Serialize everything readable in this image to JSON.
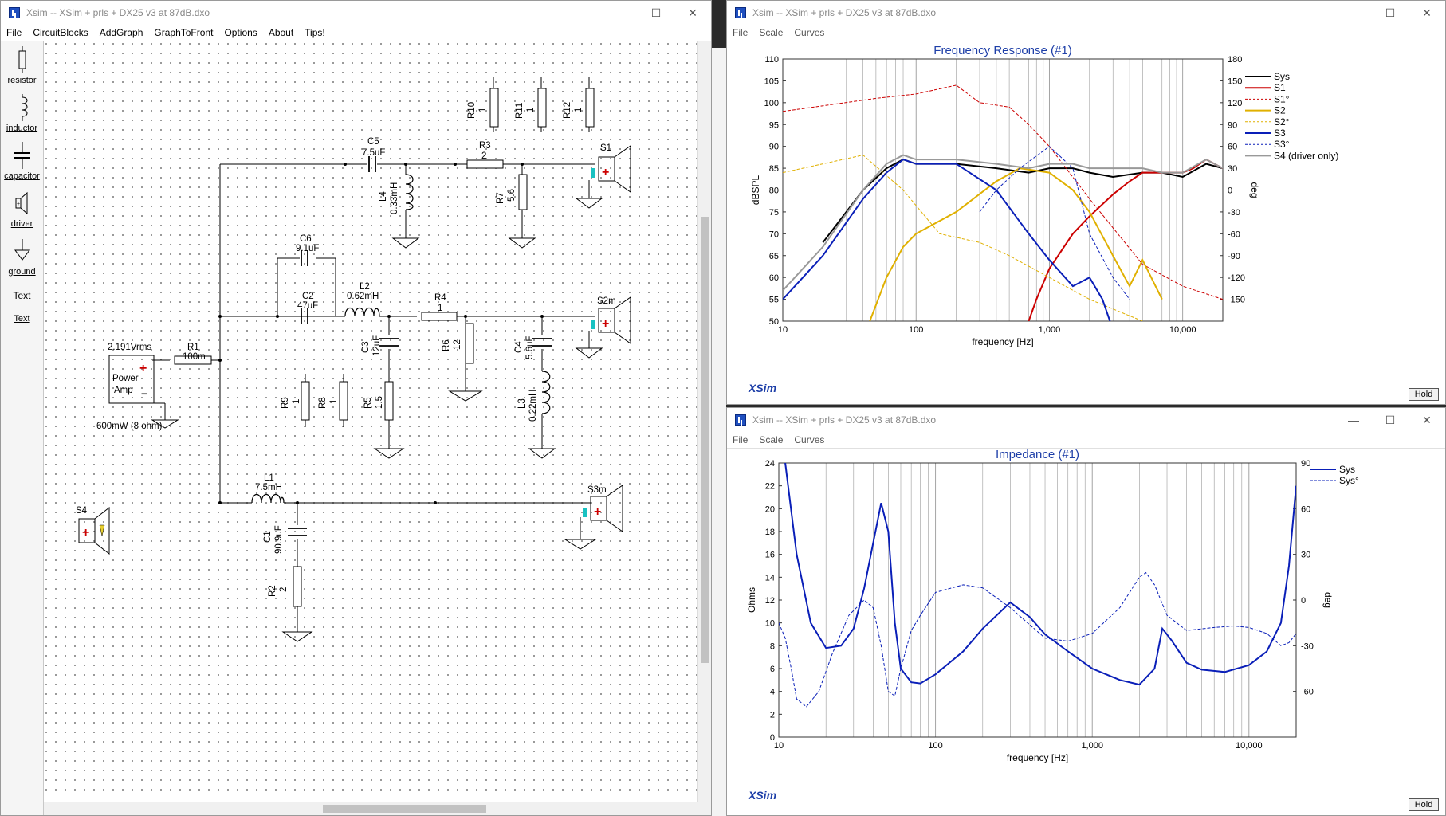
{
  "main_window": {
    "title": "Xsim -- XSim + prls + DX25 v3 at 87dB.dxo",
    "menu": [
      "File",
      "CircuitBlocks",
      "AddGraph",
      "GraphToFront",
      "Options",
      "About",
      "Tips!"
    ],
    "tools": [
      "resistor",
      "inductor",
      "capacitor",
      "driver",
      "ground",
      "Text",
      "Text"
    ]
  },
  "schematic": {
    "source": {
      "voltage": "2.191Vrms",
      "label1": "Power",
      "label2": "Amp",
      "power": "600mW (8 ohm)"
    },
    "components": [
      {
        "name": "R1",
        "value": "100m"
      },
      {
        "name": "C5",
        "value": "7.5uF"
      },
      {
        "name": "R3",
        "value": "2"
      },
      {
        "name": "L4",
        "value": "0.33mH"
      },
      {
        "name": "R7",
        "value": "5.6"
      },
      {
        "name": "R10",
        "value": "1"
      },
      {
        "name": "R11",
        "value": "1"
      },
      {
        "name": "R12",
        "value": "1"
      },
      {
        "name": "C6",
        "value": "9.1uF"
      },
      {
        "name": "C2",
        "value": "47uF"
      },
      {
        "name": "L2",
        "value": "0.62mH"
      },
      {
        "name": "R4",
        "value": "1"
      },
      {
        "name": "C3",
        "value": "12uF"
      },
      {
        "name": "R6",
        "value": "12"
      },
      {
        "name": "C4",
        "value": "5.6uF"
      },
      {
        "name": "L3",
        "value": "0.22mH"
      },
      {
        "name": "R9",
        "value": "1"
      },
      {
        "name": "R8",
        "value": "1"
      },
      {
        "name": "R5",
        "value": "1.5"
      },
      {
        "name": "L1",
        "value": "7.5mH"
      },
      {
        "name": "C1",
        "value": "90.9uF"
      },
      {
        "name": "R2",
        "value": "2"
      }
    ],
    "drivers": [
      "S1",
      "S2m",
      "S3m",
      "S4"
    ]
  },
  "freq_window": {
    "title": "Xsim -- XSim + prls + DX25 v3 at 87dB.dxo",
    "menu": [
      "File",
      "Scale",
      "Curves"
    ],
    "hold": "Hold",
    "brand": "XSim"
  },
  "imp_window": {
    "title": "Xsim -- XSim + prls + DX25 v3 at 87dB.dxo",
    "menu": [
      "File",
      "Scale",
      "Curves"
    ],
    "hold": "Hold",
    "brand": "XSim"
  },
  "chart_data": [
    {
      "type": "line",
      "title": "Frequency Response (#1)",
      "xlabel": "frequency [Hz]",
      "ylabel": "dBSPL",
      "y2label": "deg",
      "xscale": "log",
      "xlim": [
        10,
        20000
      ],
      "ylim": [
        50,
        110
      ],
      "y2lim": [
        -180,
        180
      ],
      "xticks": [
        "10",
        "100",
        "1,000",
        "10,000"
      ],
      "yticks": [
        110,
        105,
        100,
        95,
        90,
        85,
        80,
        75,
        70,
        65,
        60,
        55,
        50
      ],
      "y2ticks": [
        180,
        150,
        120,
        90,
        60,
        30,
        0,
        -30,
        -60,
        -90,
        -120,
        -150
      ],
      "grid": true,
      "legend_position": "right",
      "series": [
        {
          "name": "Sys",
          "color": "#000000",
          "style": "solid",
          "x": [
            20,
            40,
            60,
            80,
            100,
            200,
            400,
            700,
            1000,
            1500,
            2000,
            3000,
            5000,
            7000,
            10000,
            15000,
            20000
          ],
          "y": [
            68,
            80,
            85,
            87,
            86,
            86,
            85,
            84,
            85,
            85,
            84,
            83,
            84,
            84,
            83,
            86,
            85
          ]
        },
        {
          "name": "S1",
          "color": "#cc0000",
          "style": "solid",
          "x": [
            700,
            800,
            1000,
            1500,
            2000,
            3000,
            4000,
            5000,
            7000,
            10000,
            12000,
            15000,
            20000
          ],
          "y": [
            50,
            55,
            62,
            70,
            74,
            79,
            82,
            84,
            84,
            84,
            85,
            87,
            85
          ]
        },
        {
          "name": "S1°",
          "color": "#cc0000",
          "style": "dashed",
          "x": [
            10,
            50,
            100,
            200,
            300,
            500,
            700,
            1000,
            2000,
            5000,
            10000,
            20000
          ],
          "y": [
            98,
            101,
            102,
            104,
            100,
            99,
            95,
            90,
            78,
            63,
            58,
            55
          ]
        },
        {
          "name": "S2",
          "color": "#e0b000",
          "style": "solid",
          "x": [
            45,
            60,
            80,
            100,
            200,
            400,
            600,
            1000,
            1500,
            2000,
            3000,
            4000,
            5000,
            7000
          ],
          "y": [
            50,
            60,
            67,
            70,
            75,
            82,
            85,
            84,
            80,
            75,
            65,
            58,
            64,
            55
          ]
        },
        {
          "name": "S2°",
          "color": "#e0b000",
          "style": "dashed",
          "x": [
            10,
            20,
            40,
            80,
            150,
            300,
            500,
            1000,
            2000,
            5000
          ],
          "y": [
            84,
            86,
            88,
            80,
            70,
            68,
            65,
            60,
            55,
            50
          ]
        },
        {
          "name": "S3",
          "color": "#0a1fb8",
          "style": "solid",
          "x": [
            10,
            20,
            40,
            60,
            80,
            100,
            200,
            400,
            700,
            1000,
            1500,
            2000,
            2500,
            3000
          ],
          "y": [
            55,
            65,
            78,
            84,
            87,
            86,
            86,
            80,
            70,
            64,
            58,
            60,
            55,
            48
          ]
        },
        {
          "name": "S3°",
          "color": "#0a1fb8",
          "style": "dashed",
          "x": [
            300,
            400,
            600,
            1000,
            1500,
            2000,
            3000,
            4000
          ],
          "y": [
            75,
            80,
            85,
            90,
            85,
            70,
            60,
            55
          ]
        },
        {
          "name": "S4 (driver only)",
          "color": "#999999",
          "style": "solid",
          "x": [
            10,
            20,
            40,
            60,
            80,
            100,
            200,
            400,
            700,
            1000,
            1500,
            2000,
            3000,
            5000,
            7000,
            10000,
            15000,
            20000
          ],
          "y": [
            57,
            67,
            80,
            86,
            88,
            87,
            87,
            86,
            85,
            86,
            86,
            85,
            85,
            85,
            84,
            84,
            87,
            85
          ]
        }
      ]
    },
    {
      "type": "line",
      "title": "Impedance (#1)",
      "xlabel": "frequency [Hz]",
      "ylabel": "Ohms",
      "y2label": "deg",
      "xscale": "log",
      "xlim": [
        10,
        20000
      ],
      "ylim": [
        0,
        24
      ],
      "y2lim": [
        -90,
        90
      ],
      "xticks": [
        "10",
        "100",
        "1,000",
        "10,000"
      ],
      "yticks": [
        24,
        22,
        20,
        18,
        16,
        14,
        12,
        10,
        8,
        6,
        4,
        2,
        0
      ],
      "y2ticks": [
        90,
        60,
        30,
        0,
        -30,
        -60
      ],
      "grid": true,
      "legend_position": "top-right",
      "series": [
        {
          "name": "Sys",
          "color": "#0a1fb8",
          "style": "solid",
          "x": [
            10,
            11,
            13,
            16,
            20,
            25,
            30,
            35,
            40,
            45,
            50,
            55,
            60,
            70,
            80,
            100,
            150,
            200,
            300,
            400,
            500,
            700,
            1000,
            1500,
            2000,
            2500,
            2800,
            3200,
            4000,
            5000,
            7000,
            10000,
            13000,
            16000,
            18000,
            20000
          ],
          "y": [
            30,
            24,
            16,
            10,
            7.8,
            8,
            9.5,
            13,
            17,
            20.5,
            18,
            10,
            6,
            4.8,
            4.7,
            5.5,
            7.5,
            9.5,
            11.8,
            10.5,
            9,
            7.5,
            6,
            5,
            4.6,
            6,
            9.5,
            8.5,
            6.5,
            5.9,
            5.7,
            6.3,
            7.5,
            10,
            15,
            22
          ]
        },
        {
          "name": "Sys°",
          "color": "#0a1fb8",
          "style": "dashed",
          "x": [
            10,
            11,
            12,
            13,
            15,
            18,
            22,
            28,
            35,
            40,
            45,
            50,
            55,
            60,
            70,
            80,
            100,
            150,
            200,
            300,
            500,
            700,
            1000,
            1500,
            2000,
            2200,
            2500,
            3000,
            4000,
            6000,
            8000,
            10000,
            13000,
            16000,
            18000,
            20000
          ],
          "y": [
            -15,
            -25,
            -45,
            -65,
            -70,
            -60,
            -35,
            -10,
            0,
            -5,
            -30,
            -60,
            -63,
            -45,
            -20,
            -10,
            5,
            10,
            8,
            -5,
            -25,
            -27,
            -22,
            -5,
            15,
            18,
            10,
            -10,
            -20,
            -18,
            -17,
            -18,
            -22,
            -30,
            -28,
            -22
          ]
        }
      ]
    }
  ]
}
